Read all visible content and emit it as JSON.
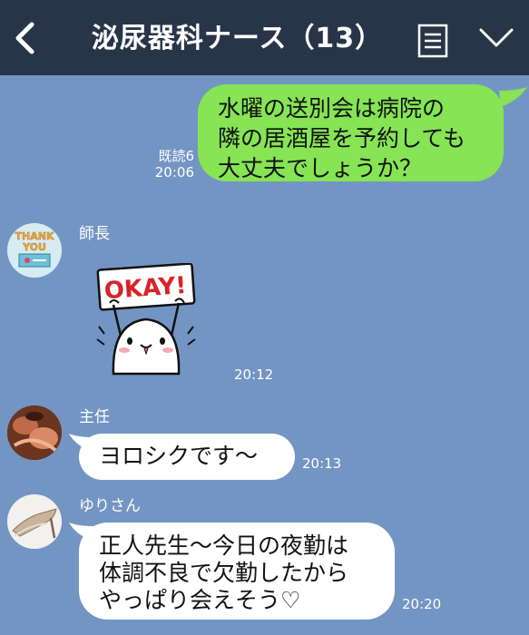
{
  "header": {
    "title": "泌尿器科ナース（13）",
    "back_icon": "chevron-left-icon",
    "menu_icon": "menu-list-icon",
    "collapse_icon": "chevron-down-icon",
    "bg_color": "#283549"
  },
  "chat": {
    "bg_color": "#7395c3",
    "outgoing_color": "#86e455",
    "messages": [
      {
        "direction": "outgoing",
        "lines": [
          "水曜の送別会は病院の",
          "隣の居酒屋を予約しても",
          "大丈夫でしょうか？"
        ],
        "read": "既読6",
        "time": "20:06"
      },
      {
        "direction": "incoming",
        "sender": "師長",
        "sticker_text": "OKAY!",
        "avatar_text": [
          "THANK",
          "YOU"
        ],
        "time": "20:12"
      },
      {
        "direction": "incoming",
        "sender": "主任",
        "text": "ヨロシクです〜",
        "time": "20:13"
      },
      {
        "direction": "incoming",
        "sender": "ゆりさん",
        "lines": [
          "正人先生〜今日の夜勤は",
          "体調不良で欠勤したから",
          "やっぱり会えそう♡"
        ],
        "time": "20:20"
      }
    ]
  }
}
